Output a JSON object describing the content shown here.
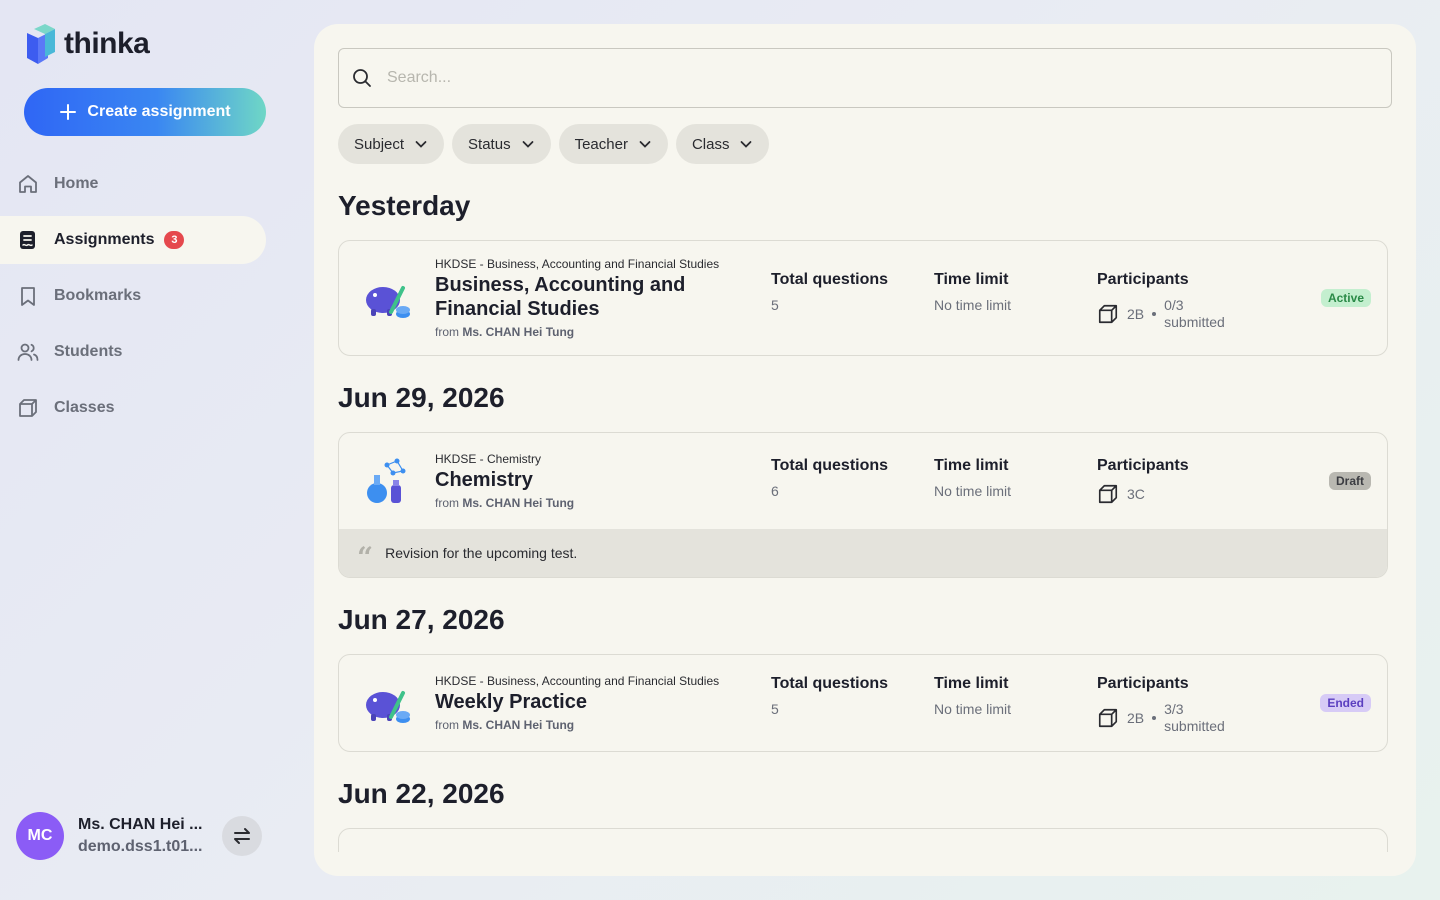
{
  "app": {
    "name": "thinka",
    "brand_color": "#2f66f5"
  },
  "sidebar": {
    "create_label": "Create assignment",
    "items": [
      {
        "label": "Home",
        "icon": "home-icon"
      },
      {
        "label": "Assignments",
        "icon": "assignment-icon",
        "badge": "3",
        "active": true
      },
      {
        "label": "Bookmarks",
        "icon": "bookmark-icon"
      },
      {
        "label": "Students",
        "icon": "users-icon"
      },
      {
        "label": "Classes",
        "icon": "cube-icon"
      }
    ],
    "profile": {
      "initials": "MC",
      "name": "Ms. CHAN Hei ...",
      "email": "demo.dss1.t01..."
    }
  },
  "search": {
    "placeholder": "Search..."
  },
  "filters": [
    "Subject",
    "Status",
    "Teacher",
    "Class"
  ],
  "labels": {
    "total_questions": "Total questions",
    "time_limit": "Time limit",
    "participants": "Participants",
    "from": "from"
  },
  "groups": [
    {
      "date": "Yesterday",
      "card": {
        "subject": "HKDSE - Business, Accounting and Financial Studies",
        "title": "Business, Accounting and Financial Studies",
        "teacher": "Ms. CHAN Hei Tung",
        "total_questions": "5",
        "time_limit": "No time limit",
        "class": "2B",
        "submitted_count": "0/3",
        "submitted_label": "submitted",
        "status": "Active"
      }
    },
    {
      "date": "Jun 29, 2026",
      "card": {
        "subject": "HKDSE - Chemistry",
        "title": "Chemistry",
        "teacher": "Ms. CHAN Hei Tung",
        "total_questions": "6",
        "time_limit": "No time limit",
        "class": "3C",
        "status": "Draft",
        "note": "Revision for the upcoming test."
      }
    },
    {
      "date": "Jun 27, 2026",
      "card": {
        "subject": "HKDSE - Business, Accounting and Financial Studies",
        "title": "Weekly Practice",
        "teacher": "Ms. CHAN Hei Tung",
        "total_questions": "5",
        "time_limit": "No time limit",
        "class": "2B",
        "submitted_count": "3/3",
        "submitted_label": "submitted",
        "status": "Ended"
      }
    },
    {
      "date": "Jun 22, 2026"
    }
  ]
}
